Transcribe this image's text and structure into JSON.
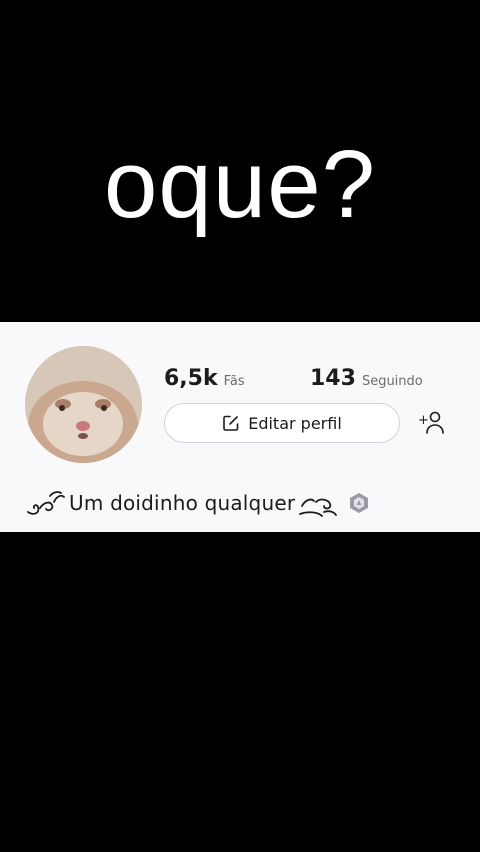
{
  "caption": "oque?",
  "profile": {
    "fans_count": "6,5k",
    "fans_label": "Fãs",
    "following_count": "143",
    "following_label": "Seguindo",
    "edit_button_label": "Editar perfil",
    "bio": "Um doidinho qualquer",
    "icons": {
      "edit": "edit-square-icon",
      "add_friend": "add-user-icon",
      "badge": "shield-badge-icon",
      "deco": "swirl-decoration-icon"
    }
  },
  "colors": {
    "background": "#000000",
    "card": "#f9f9fb",
    "text": "#1c1c1e",
    "muted": "#6b6b70",
    "border": "#d2d2d6"
  }
}
